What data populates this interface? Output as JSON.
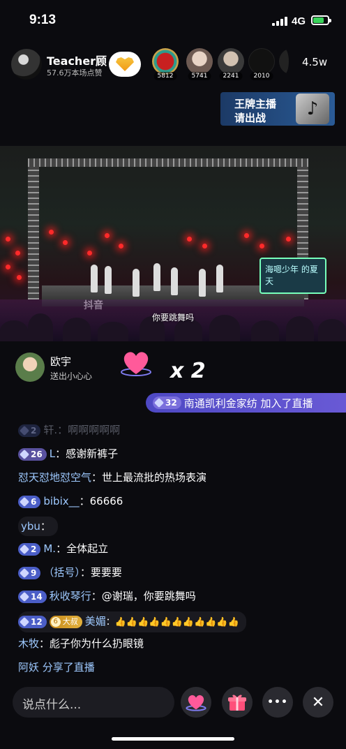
{
  "status": {
    "time": "9:13",
    "network": "4G"
  },
  "host": {
    "name": "Teacher顾",
    "likes": "57.6万本场点赞"
  },
  "viewers": [
    {
      "count": "5812"
    },
    {
      "count": "5741"
    },
    {
      "count": "2241"
    },
    {
      "count": "2010"
    }
  ],
  "viewers_total": "4.5w",
  "challenge": {
    "line1": "王牌主播",
    "line2": "请出战"
  },
  "stage": {
    "subtitle": "你要跳舞吗",
    "sign": "海嗯少年 的夏天",
    "watermark": "抖音"
  },
  "gift": {
    "user": "欧宇",
    "action": "送出小心心",
    "count": "x 2"
  },
  "joined": {
    "level": "32",
    "text": "南通凯利金家纺 加入了直播"
  },
  "chat": [
    {
      "level": "2",
      "user": "轩.",
      "message": "：啊啊啊啊啊"
    },
    {
      "level": "26",
      "user": "L",
      "message": "：感谢新裤子"
    },
    {
      "user": "怼天怼地怼空气",
      "message": "：世上最流批的热场表演"
    },
    {
      "level": "6",
      "user": "bibix__",
      "message": "：66666"
    },
    {
      "user": "ybu",
      "message": "："
    },
    {
      "level": "2",
      "user": "M.",
      "message": "：全体起立"
    },
    {
      "level": "9",
      "user": "（括号）",
      "message": "：要要要"
    },
    {
      "level": "14",
      "user": "秋收琴行",
      "message": "：@谢瑞，你要跳舞吗"
    },
    {
      "level": "12",
      "fan_level": "6",
      "fan_club": "大叔",
      "user": "美媚",
      "message": "：👍👍👍👍👍👍👍👍👍👍👍"
    },
    {
      "user": "木牧",
      "message": "：彪子你为什么扔眼镜"
    },
    {
      "user": "阿妖",
      "message": " 分享了直播"
    }
  ],
  "bottom": {
    "placeholder": "说点什么...",
    "more": "•••",
    "close": "✕"
  },
  "colors": {
    "level_badge": "#4b5ec7",
    "name": "#9ec9ff",
    "joined_bg": "#5a52cc",
    "fan_badge": "#d9a12e"
  }
}
